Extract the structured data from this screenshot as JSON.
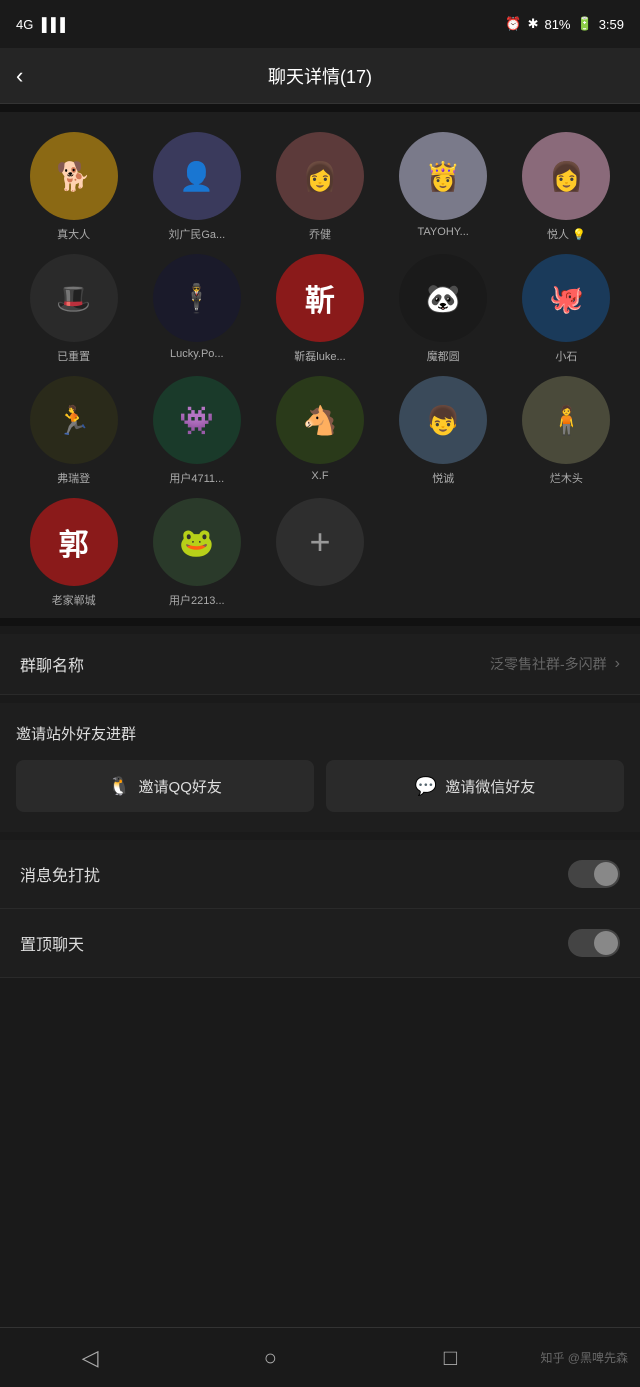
{
  "statusBar": {
    "signal": "4G",
    "time": "3:59",
    "battery": "81%",
    "icons": [
      "alarm",
      "bluetooth",
      "battery"
    ]
  },
  "header": {
    "title": "聊天详情(17)",
    "backLabel": "<"
  },
  "members": [
    {
      "id": 1,
      "name": "真大人",
      "avatarText": "🐕",
      "avatarBg": "#8B6914",
      "emoji": "🐕"
    },
    {
      "id": 2,
      "name": "刘广民Ga...",
      "avatarText": "👤",
      "avatarBg": "#3a3a5c",
      "emoji": "👤"
    },
    {
      "id": 3,
      "name": "乔健",
      "avatarText": "👩",
      "avatarBg": "#5c3a3a",
      "emoji": "👩"
    },
    {
      "id": 4,
      "name": "TAYOHY...",
      "avatarText": "👸",
      "avatarBg": "#7a7a8a",
      "emoji": "👸"
    },
    {
      "id": 5,
      "name": "悦人 💡",
      "avatarText": "👩‍🎤",
      "avatarBg": "#8a6a7a",
      "emoji": "👩‍🎤"
    },
    {
      "id": 6,
      "name": "已重置",
      "avatarText": "🎩",
      "avatarBg": "#2a2a2a",
      "emoji": "🎩"
    },
    {
      "id": 7,
      "name": "Lucky.Po...",
      "avatarText": "🕴",
      "avatarBg": "#1a1a2a",
      "emoji": "🕴"
    },
    {
      "id": 8,
      "name": "靳磊luke...",
      "avatarText": "靳",
      "avatarBg": "#8a1a1a",
      "emoji": "靳"
    },
    {
      "id": 9,
      "name": "魔都圆",
      "avatarText": "🐼",
      "avatarBg": "#1a1a1a",
      "emoji": "🐼"
    },
    {
      "id": 10,
      "name": "小石",
      "avatarText": "🐙",
      "avatarBg": "#1a3a5a",
      "emoji": "🐙"
    },
    {
      "id": 11,
      "name": "弗瑞登",
      "avatarText": "🏃",
      "avatarBg": "#2a2a1a",
      "emoji": "🏃"
    },
    {
      "id": 12,
      "name": "用户4711...",
      "avatarText": "👾",
      "avatarBg": "#1a3a2a",
      "emoji": "👾"
    },
    {
      "id": 13,
      "name": "X.F",
      "avatarText": "🐴",
      "avatarBg": "#2a3a1a",
      "emoji": "🐴"
    },
    {
      "id": 14,
      "name": "悦诚",
      "avatarText": "👦",
      "avatarBg": "#3a4a5a",
      "emoji": "👦"
    },
    {
      "id": 15,
      "name": "烂木头",
      "avatarText": "🧍",
      "avatarBg": "#4a4a3a",
      "emoji": "🧍"
    },
    {
      "id": 16,
      "name": "老家郸城",
      "avatarText": "郭",
      "avatarBg": "#8a1a1a",
      "emoji": "郭"
    },
    {
      "id": 17,
      "name": "用户2213...",
      "avatarText": "🐸",
      "avatarBg": "#2a3a2a",
      "emoji": "🐸"
    }
  ],
  "addButton": {
    "label": "+"
  },
  "settings": {
    "groupName": {
      "label": "群聊名称",
      "value": "泛零售社群-多闪群"
    }
  },
  "invite": {
    "sectionLabel": "邀请站外好友进群",
    "qqButton": "邀请QQ好友",
    "wechatButton": "邀请微信好友"
  },
  "toggles": [
    {
      "label": "消息免打扰",
      "id": "mute",
      "on": false
    },
    {
      "label": "置顶聊天",
      "id": "pin",
      "on": false
    }
  ],
  "bottomNav": {
    "items": [
      "back",
      "home",
      "recent"
    ],
    "watermark": "知乎 @黑啤先森"
  }
}
